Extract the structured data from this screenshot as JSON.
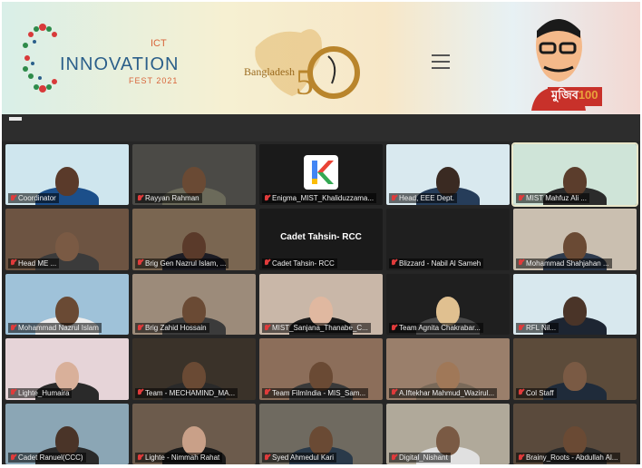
{
  "banner": {
    "logo_main": "INNOVATION",
    "logo_ict": "ICT",
    "logo_fest": "FEST 2021",
    "bd_word": "Bangladesh",
    "mujib_label": "মুজিব",
    "mujib_num": "100",
    "colors": {
      "logo": "#2b5f8a",
      "accent": "#d8653a",
      "gold": "#b9852c",
      "red": "#c8312a"
    }
  },
  "participants": [
    {
      "name": "Coordinator",
      "bg": "#cfe6ee",
      "skin": "#5a3a2a",
      "shirt": "#1c4f8a",
      "active": false
    },
    {
      "name": "Rayyan Rahman",
      "bg": "#4b4a46",
      "skin": "#6a4a34",
      "shirt": "#6b6a5a",
      "active": false
    },
    {
      "name": "Enigma_MIST_Khaliduzzama...",
      "bg": "#1a1a1a",
      "skin": "",
      "shirt": "",
      "active": false,
      "logo": true
    },
    {
      "name": "Head, EEE Dept.",
      "bg": "#d9e9ef",
      "skin": "#3a2a22",
      "shirt": "#263d5a",
      "active": false
    },
    {
      "name": "MIST Mahfuz Ali ...",
      "bg": "#cfe4d8",
      "skin": "#5b3d2c",
      "shirt": "#2b2b2b",
      "active": true
    },
    {
      "name": "Head ME ...",
      "bg": "#6d5442",
      "skin": "#7a5a44",
      "shirt": "#3b3b3b",
      "active": false
    },
    {
      "name": "Brig Gen Nazrul Islam, ...",
      "bg": "#7a6651",
      "skin": "#5a3a2a",
      "shirt": "#1c1c24",
      "active": false
    },
    {
      "name": "Cadet Tahsin- RCC",
      "bg": "#1a1a1a",
      "skin": "",
      "shirt": "",
      "active": false,
      "center": "Cadet Tahsin- RCC"
    },
    {
      "name": "Blizzard - Nabil Al Sameh",
      "bg": "#1f1f1f",
      "skin": "",
      "shirt": "",
      "active": false
    },
    {
      "name": "Mohammad Shahjahan ...",
      "bg": "#cabfb0",
      "skin": "#6a4a34",
      "shirt": "#2d3a4d",
      "active": false
    },
    {
      "name": "Mohammad Nazrul Islam",
      "bg": "#9fc2d9",
      "skin": "#6a4a34",
      "shirt": "#ededed",
      "active": false
    },
    {
      "name": "Brig Zahid Hossain",
      "bg": "#9c8b7a",
      "skin": "#6a4a34",
      "shirt": "#3b3b3b",
      "active": false
    },
    {
      "name": "MIST_Sanjana_Thanabe_C...",
      "bg": "#c9b7a8",
      "skin": "#e0b8a0",
      "shirt": "#1c1c1c",
      "active": false
    },
    {
      "name": "Team Agnita Chakrabar...",
      "bg": "#1f1f1f",
      "skin": "#e0c090",
      "shirt": "#4a4a4a",
      "active": false
    },
    {
      "name": "RFL Nil...",
      "bg": "#d8e8ee",
      "skin": "#4a3428",
      "shirt": "#1d2532",
      "active": false
    },
    {
      "name": "Lighte_Humaira",
      "bg": "#e6d4d8",
      "skin": "#d9b09a",
      "shirt": "#2a2a2a",
      "active": false
    },
    {
      "name": "Team - MECHAMIND_MA...",
      "bg": "#3a3229",
      "skin": "#6a4a34",
      "shirt": "#2a2a2a",
      "active": false
    },
    {
      "name": "Team FilmIndia - MIS_Sam...",
      "bg": "#8c6e5a",
      "skin": "#6a4a34",
      "shirt": "#3a3a3a",
      "active": false
    },
    {
      "name": "A.Iftekhar Mahmud_Wazirul...",
      "bg": "#9a7f6b",
      "skin": "#a07858",
      "shirt": "#7a6a5a",
      "active": false
    },
    {
      "name": "Col Staff",
      "bg": "#5c4b3a",
      "skin": "#7a5a44",
      "shirt": "#1f2b3a",
      "active": false
    },
    {
      "name": "Cadet Ranuel(CCC)",
      "bg": "#8ba6b5",
      "skin": "#4a3428",
      "shirt": "#2a2a2a",
      "active": false
    },
    {
      "name": "Lighte - Nimmah Rahat",
      "bg": "#6c5b4c",
      "skin": "#c9a088",
      "shirt": "#1a1a1a",
      "active": false
    },
    {
      "name": "Syed Ahmedul Kari",
      "bg": "#6f6a60",
      "skin": "#6a4a34",
      "shirt": "#2a3a4a",
      "active": false
    },
    {
      "name": "Digital_Nishant",
      "bg": "#b0a99a",
      "skin": "#7a5a44",
      "shirt": "#e0e0e0",
      "active": false
    },
    {
      "name": "Brainy_Roots - Abdullah Al...",
      "bg": "#5a4a3c",
      "skin": "#6a4a34",
      "shirt": "#2a2a2a",
      "active": false
    }
  ]
}
